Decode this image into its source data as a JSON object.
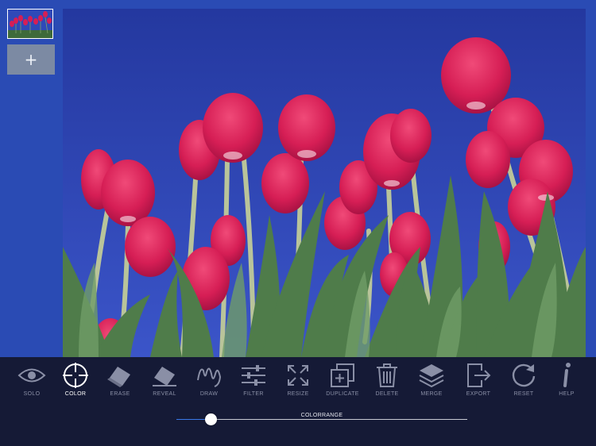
{
  "layers": {
    "thumbnail": "tulips-layer-thumbnail",
    "add_button": "+"
  },
  "image": {
    "subject": "red tulips against blue sky",
    "sky_color": "#2a3fb8",
    "petal_color": "#d61e55"
  },
  "toolbar": {
    "tools": [
      {
        "label": "SOLO",
        "icon": "eye-icon",
        "active": false
      },
      {
        "label": "COLOR",
        "icon": "crosshair-icon",
        "active": true
      },
      {
        "label": "ERASE",
        "icon": "eraser-icon",
        "active": false
      },
      {
        "label": "REVEAL",
        "icon": "eraser-icon",
        "active": false
      },
      {
        "label": "DRAW",
        "icon": "squiggle-icon",
        "active": false
      },
      {
        "label": "FILTER",
        "icon": "sliders-icon",
        "active": false
      },
      {
        "label": "RESIZE",
        "icon": "expand-icon",
        "active": false
      },
      {
        "label": "DUPLICATE",
        "icon": "duplicate-icon",
        "active": false
      },
      {
        "label": "DELETE",
        "icon": "trash-icon",
        "active": false
      },
      {
        "label": "MERGE",
        "icon": "layers-icon",
        "active": false
      },
      {
        "label": "EXPORT",
        "icon": "export-icon",
        "active": false
      },
      {
        "label": "RESET",
        "icon": "reset-icon",
        "active": false
      },
      {
        "label": "HELP",
        "icon": "info-icon",
        "active": false
      }
    ]
  },
  "slider": {
    "label": "COLORRANGE",
    "value": 0.12
  },
  "colors": {
    "background": "#2a4bb4",
    "toolbar": "#151a36",
    "accent": "#3a78e8"
  }
}
